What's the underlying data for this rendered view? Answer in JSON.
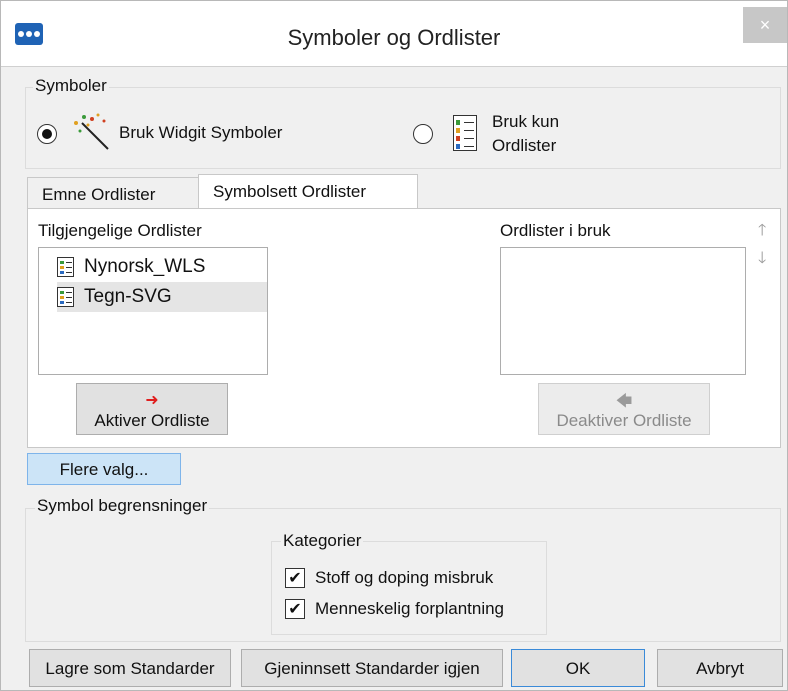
{
  "window": {
    "title": "Symboler og Ordlister",
    "close_label": "×"
  },
  "symbols_group": {
    "label": "Symboler",
    "radio_widgit": {
      "label": "Bruk Widgit Symboler",
      "checked": true
    },
    "radio_lists": {
      "label_line1": "Bruk kun",
      "label_line2": "Ordlister",
      "checked": false
    }
  },
  "tabs": [
    {
      "label": "Emne Ordlister",
      "active": false
    },
    {
      "label": "Symbolsett Ordlister",
      "active": true
    }
  ],
  "available": {
    "label": "Tilgjengelige Ordlister",
    "items": [
      {
        "label": "Nynorsk_WLS",
        "selected": false
      },
      {
        "label": "Tegn-SVG",
        "selected": true
      }
    ],
    "activate_button": "Aktiver Ordliste"
  },
  "in_use": {
    "label": "Ordlister i bruk",
    "items": [],
    "deactivate_button": "Deaktiver Ordliste"
  },
  "more_options_button": "Flere valg...",
  "restrictions": {
    "label": "Symbol begrensninger",
    "categories_label": "Kategorier",
    "categories": [
      {
        "label": "Stoff og doping misbruk",
        "checked": true
      },
      {
        "label": "Menneskelig forplantning",
        "checked": true
      }
    ]
  },
  "footer": {
    "save_default": "Lagre som Standarder",
    "restore_default": "Gjeninnsett Standarder igjen",
    "ok": "OK",
    "cancel": "Avbryt"
  },
  "icons": {
    "app": "app-icon",
    "widgit": "magic-wand-icon",
    "list": "list-icon",
    "arrow_right": "arrow-right-icon",
    "arrow_left": "arrow-left-icon",
    "up": "arrow-up-icon",
    "down": "arrow-down-icon"
  },
  "colors": {
    "selected_button": "#cce4f7",
    "accent_red": "#e01e1e"
  }
}
